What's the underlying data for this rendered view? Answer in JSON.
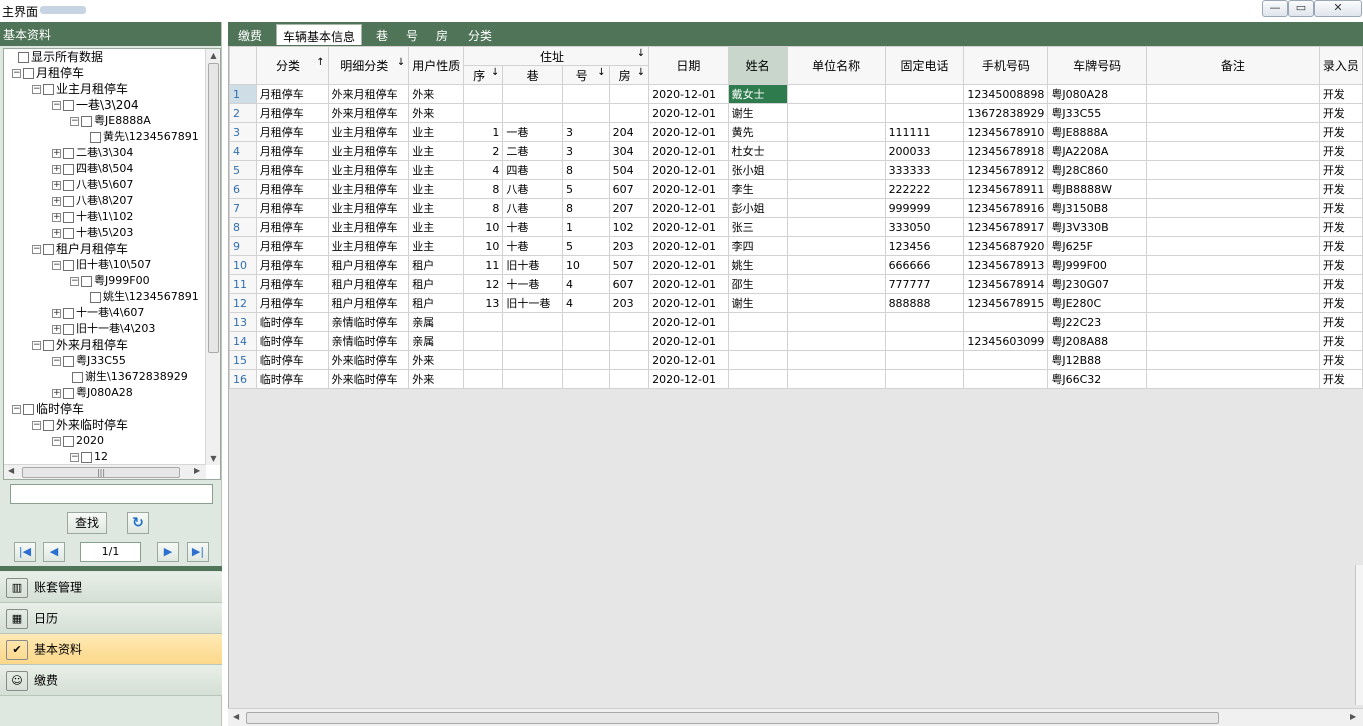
{
  "window": {
    "title": "主界面",
    "min": "—",
    "max": "▭",
    "close": "✕"
  },
  "left": {
    "header": "基本资料",
    "tree": [
      {
        "label": "显示所有数据",
        "x": 14,
        "exp": ""
      },
      {
        "label": "月租停车",
        "x": 8,
        "exp": "−"
      },
      {
        "label": "业主月租停车",
        "x": 28,
        "exp": "−"
      },
      {
        "label": "一巷\\3\\204",
        "x": 48,
        "exp": "−"
      },
      {
        "label": "粤JE8888A",
        "x": 66,
        "exp": "−",
        "small": true
      },
      {
        "label": "黄先\\1234567891",
        "x": 86,
        "exp": "",
        "small": true
      },
      {
        "label": "二巷\\3\\304",
        "x": 48,
        "exp": "+",
        "small": true
      },
      {
        "label": "四巷\\8\\504",
        "x": 48,
        "exp": "+",
        "small": true
      },
      {
        "label": "八巷\\5\\607",
        "x": 48,
        "exp": "+",
        "small": true
      },
      {
        "label": "八巷\\8\\207",
        "x": 48,
        "exp": "+",
        "small": true
      },
      {
        "label": "十巷\\1\\102",
        "x": 48,
        "exp": "+",
        "small": true
      },
      {
        "label": "十巷\\5\\203",
        "x": 48,
        "exp": "+",
        "small": true
      },
      {
        "label": "租户月租停车",
        "x": 28,
        "exp": "−"
      },
      {
        "label": "旧十巷\\10\\507",
        "x": 48,
        "exp": "−",
        "small": true
      },
      {
        "label": "粤J999F00",
        "x": 66,
        "exp": "−",
        "small": true
      },
      {
        "label": "姚生\\1234567891",
        "x": 86,
        "exp": "",
        "small": true
      },
      {
        "label": "十一巷\\4\\607",
        "x": 48,
        "exp": "+",
        "small": true
      },
      {
        "label": "旧十一巷\\4\\203",
        "x": 48,
        "exp": "+",
        "small": true
      },
      {
        "label": "外来月租停车",
        "x": 28,
        "exp": "−"
      },
      {
        "label": "粤J33C55",
        "x": 48,
        "exp": "−",
        "small": true
      },
      {
        "label": "谢生\\13672838929",
        "x": 68,
        "exp": "",
        "small": true
      },
      {
        "label": "粤J080A28",
        "x": 48,
        "exp": "+",
        "small": true
      },
      {
        "label": "临时停车",
        "x": 8,
        "exp": "−"
      },
      {
        "label": "外来临时停车",
        "x": 28,
        "exp": "−"
      },
      {
        "label": "2020",
        "x": 48,
        "exp": "−",
        "small": true
      },
      {
        "label": "12",
        "x": 66,
        "exp": "−",
        "small": true
      }
    ],
    "search_value": "",
    "find_label": "查找",
    "refresh_icon": "↻",
    "page": "1/1",
    "nav": {
      "first": "|◀",
      "prev": "◀",
      "next": "▶",
      "last": "▶|"
    },
    "modules": [
      {
        "label": "账套管理",
        "icon": "books-icon",
        "glyph": "▥"
      },
      {
        "label": "日历",
        "icon": "calendar-icon",
        "glyph": "▦"
      },
      {
        "label": "基本资料",
        "icon": "checklist-icon",
        "glyph": "✔",
        "active": true
      },
      {
        "label": "缴费",
        "icon": "id-card-icon",
        "glyph": "☺"
      }
    ]
  },
  "tabs": [
    {
      "label": "缴费"
    },
    {
      "label": "车辆基本信息",
      "active": true
    },
    {
      "label": "巷"
    },
    {
      "label": "号"
    },
    {
      "label": "房"
    },
    {
      "label": "分类"
    }
  ],
  "grid": {
    "headers": {
      "category": "分类",
      "sub_category": "明细分类",
      "user_type": "用户性质",
      "address": "住址",
      "seq": "序",
      "lane": "巷",
      "no": "号",
      "room": "房",
      "date": "日期",
      "name": "姓名",
      "company": "单位名称",
      "phone": "固定电话",
      "mobile": "手机号码",
      "plate": "车牌号码",
      "note": "备注",
      "operator": "录入员"
    },
    "rows": [
      {
        "n": "1",
        "cat": "月租停车",
        "sub": "外来月租停车",
        "ut": "外来",
        "seq": "",
        "lane": "",
        "no": "",
        "room": "",
        "date": "2020-12-01",
        "name": "戴女士",
        "company": "",
        "phone": "",
        "mobile": "12345008898",
        "plate": "粤J080A28",
        "note": "",
        "op": "开发"
      },
      {
        "n": "2",
        "cat": "月租停车",
        "sub": "外来月租停车",
        "ut": "外来",
        "seq": "",
        "lane": "",
        "no": "",
        "room": "",
        "date": "2020-12-01",
        "name": "谢生",
        "company": "",
        "phone": "",
        "mobile": "13672838929",
        "plate": "粤J33C55",
        "note": "",
        "op": "开发"
      },
      {
        "n": "3",
        "cat": "月租停车",
        "sub": "业主月租停车",
        "ut": "业主",
        "seq": "1",
        "lane": "一巷",
        "no": "3",
        "room": "204",
        "date": "2020-12-01",
        "name": "黄先",
        "company": "",
        "phone": "111111",
        "mobile": "12345678910",
        "plate": "粤JE8888A",
        "note": "",
        "op": "开发"
      },
      {
        "n": "4",
        "cat": "月租停车",
        "sub": "业主月租停车",
        "ut": "业主",
        "seq": "2",
        "lane": "二巷",
        "no": "3",
        "room": "304",
        "date": "2020-12-01",
        "name": "杜女士",
        "company": "",
        "phone": "200033",
        "mobile": "12345678918",
        "plate": "粤JA2208A",
        "note": "",
        "op": "开发"
      },
      {
        "n": "5",
        "cat": "月租停车",
        "sub": "业主月租停车",
        "ut": "业主",
        "seq": "4",
        "lane": "四巷",
        "no": "8",
        "room": "504",
        "date": "2020-12-01",
        "name": "张小姐",
        "company": "",
        "phone": "333333",
        "mobile": "12345678912",
        "plate": "粤J28C860",
        "note": "",
        "op": "开发"
      },
      {
        "n": "6",
        "cat": "月租停车",
        "sub": "业主月租停车",
        "ut": "业主",
        "seq": "8",
        "lane": "八巷",
        "no": "5",
        "room": "607",
        "date": "2020-12-01",
        "name": "李生",
        "company": "",
        "phone": "222222",
        "mobile": "12345678911",
        "plate": "粤JB8888W",
        "note": "",
        "op": "开发"
      },
      {
        "n": "7",
        "cat": "月租停车",
        "sub": "业主月租停车",
        "ut": "业主",
        "seq": "8",
        "lane": "八巷",
        "no": "8",
        "room": "207",
        "date": "2020-12-01",
        "name": "彭小姐",
        "company": "",
        "phone": "999999",
        "mobile": "12345678916",
        "plate": "粤J3150B8",
        "note": "",
        "op": "开发"
      },
      {
        "n": "8",
        "cat": "月租停车",
        "sub": "业主月租停车",
        "ut": "业主",
        "seq": "10",
        "lane": "十巷",
        "no": "1",
        "room": "102",
        "date": "2020-12-01",
        "name": "张三",
        "company": "",
        "phone": "333050",
        "mobile": "12345678917",
        "plate": "粤J3V330B",
        "note": "",
        "op": "开发"
      },
      {
        "n": "9",
        "cat": "月租停车",
        "sub": "业主月租停车",
        "ut": "业主",
        "seq": "10",
        "lane": "十巷",
        "no": "5",
        "room": "203",
        "date": "2020-12-01",
        "name": "李四",
        "company": "",
        "phone": "123456",
        "mobile": "12345687920",
        "plate": "粤J625F",
        "note": "",
        "op": "开发"
      },
      {
        "n": "10",
        "cat": "月租停车",
        "sub": "租户月租停车",
        "ut": "租户",
        "seq": "11",
        "lane": "旧十巷",
        "no": "10",
        "room": "507",
        "date": "2020-12-01",
        "name": "姚生",
        "company": "",
        "phone": "666666",
        "mobile": "12345678913",
        "plate": "粤J999F00",
        "note": "",
        "op": "开发"
      },
      {
        "n": "11",
        "cat": "月租停车",
        "sub": "租户月租停车",
        "ut": "租户",
        "seq": "12",
        "lane": "十一巷",
        "no": "4",
        "room": "607",
        "date": "2020-12-01",
        "name": "邵生",
        "company": "",
        "phone": "777777",
        "mobile": "12345678914",
        "plate": "粤J230G07",
        "note": "",
        "op": "开发"
      },
      {
        "n": "12",
        "cat": "月租停车",
        "sub": "租户月租停车",
        "ut": "租户",
        "seq": "13",
        "lane": "旧十一巷",
        "no": "4",
        "room": "203",
        "date": "2020-12-01",
        "name": "谢生",
        "company": "",
        "phone": "888888",
        "mobile": "12345678915",
        "plate": "粤JE280C",
        "note": "",
        "op": "开发"
      },
      {
        "n": "13",
        "cat": "临时停车",
        "sub": "亲情临时停车",
        "ut": "亲属",
        "seq": "",
        "lane": "",
        "no": "",
        "room": "",
        "date": "2020-12-01",
        "name": "",
        "company": "",
        "phone": "",
        "mobile": "",
        "plate": "粤J22C23",
        "note": "",
        "op": "开发"
      },
      {
        "n": "14",
        "cat": "临时停车",
        "sub": "亲情临时停车",
        "ut": "亲属",
        "seq": "",
        "lane": "",
        "no": "",
        "room": "",
        "date": "2020-12-01",
        "name": "",
        "company": "",
        "phone": "",
        "mobile": "12345603099",
        "plate": "粤J208A88",
        "note": "",
        "op": "开发"
      },
      {
        "n": "15",
        "cat": "临时停车",
        "sub": "外来临时停车",
        "ut": "外来",
        "seq": "",
        "lane": "",
        "no": "",
        "room": "",
        "date": "2020-12-01",
        "name": "",
        "company": "",
        "phone": "",
        "mobile": "",
        "plate": "粤J12B88",
        "note": "",
        "op": "开发"
      },
      {
        "n": "16",
        "cat": "临时停车",
        "sub": "外来临时停车",
        "ut": "外来",
        "seq": "",
        "lane": "",
        "no": "",
        "room": "",
        "date": "2020-12-01",
        "name": "",
        "company": "",
        "phone": "",
        "mobile": "",
        "plate": "粤J66C32",
        "note": "",
        "op": "开发"
      }
    ]
  },
  "colors": {
    "accent": "#4f7457",
    "selected_cell": "#2e7c4d",
    "active_module": "#fbd88a"
  }
}
